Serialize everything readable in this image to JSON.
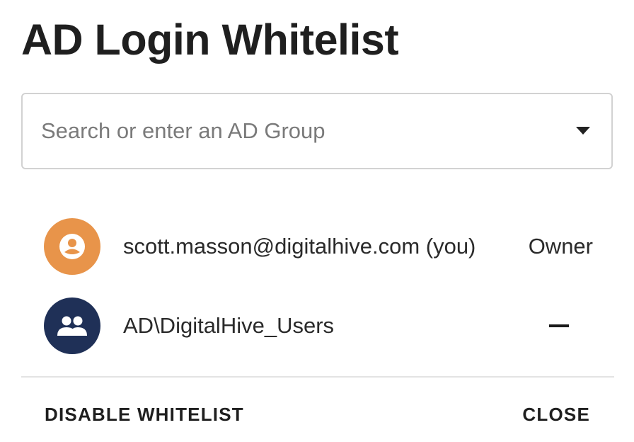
{
  "dialog": {
    "title": "AD Login Whitelist"
  },
  "search": {
    "placeholder": "Search or enter an AD Group",
    "value": "",
    "dropdown_icon": "caret-down-icon"
  },
  "members": [
    {
      "name": "scott.masson@digitalhive.com (you)",
      "role": "Owner",
      "avatar_icon": "user-circle-icon",
      "avatar_color": "#e8944a"
    },
    {
      "name": "AD\\DigitalHive_Users",
      "role": "",
      "action_icon": "remove-dash-icon",
      "avatar_icon": "user-group-icon",
      "avatar_color": "#1f3057"
    }
  ],
  "footer": {
    "disable_label": "DISABLE WHITELIST",
    "close_label": "CLOSE"
  }
}
